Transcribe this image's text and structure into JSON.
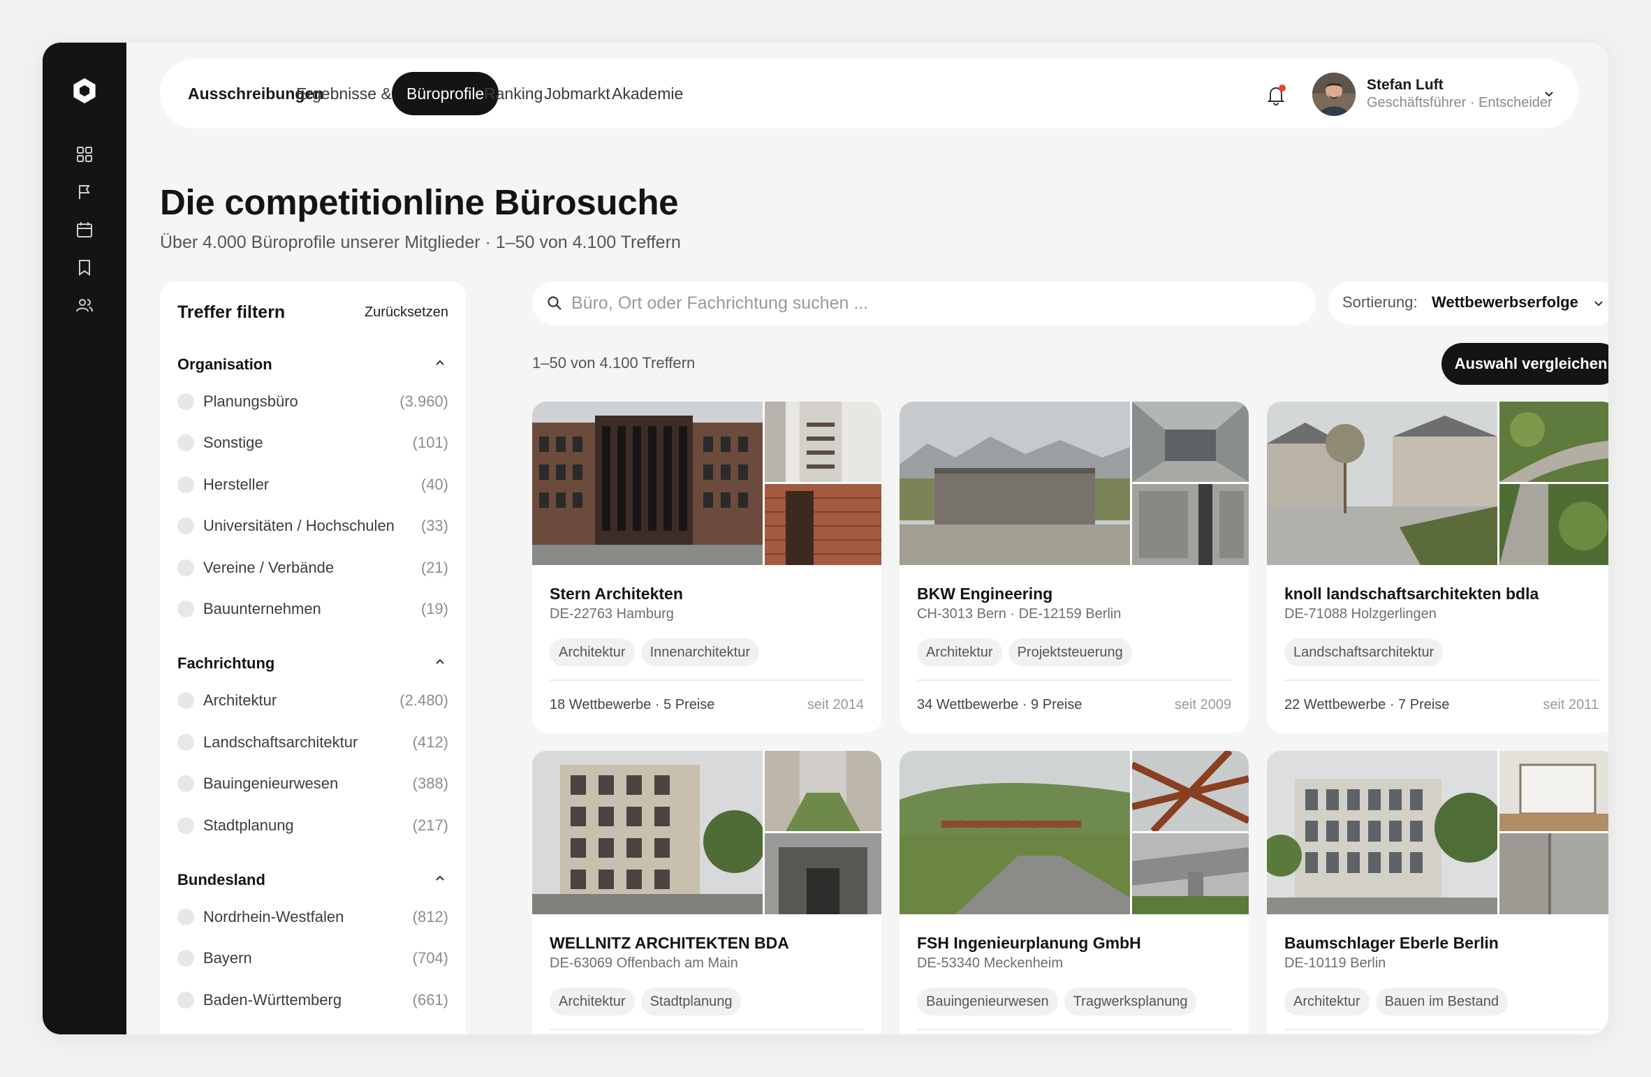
{
  "nav": {
    "tabs": [
      {
        "label": "Ausschreibungen"
      },
      {
        "label": "Ergebnisse & News"
      },
      {
        "label": "Büroprofile"
      },
      {
        "label": "Ranking"
      },
      {
        "label": "Jobmarkt"
      },
      {
        "label": "Akademie"
      }
    ],
    "active_tab": "Büroprofile"
  },
  "user": {
    "name": "Stefan Luft",
    "role": "Geschäftsführer · Entscheider"
  },
  "sidebar_icons": [
    "logo-icon",
    "grid-icon",
    "flag-icon",
    "calendar-icon",
    "bookmark-icon",
    "users-icon"
  ],
  "page": {
    "title": "Die competitionline Bürosuche",
    "subtitle": "Über 4.000 Büroprofile unserer Mitglieder · 1–50 von 4.100 Treffern"
  },
  "filters": {
    "title": "Treffer filtern",
    "reset_label": "Zurücksetzen",
    "groups": [
      {
        "title": "Organisation",
        "items": [
          {
            "label": "Planungsbüro",
            "count": "(3.960)"
          },
          {
            "label": "Sonstige",
            "count": "(101)"
          },
          {
            "label": "Hersteller",
            "count": "(40)"
          },
          {
            "label": "Universitäten / Hochschulen",
            "count": "(33)"
          },
          {
            "label": "Vereine / Verbände",
            "count": "(21)"
          },
          {
            "label": "Bauunternehmen",
            "count": "(19)"
          }
        ]
      },
      {
        "title": "Fachrichtung",
        "items": [
          {
            "label": "Architektur",
            "count": "(2.480)"
          },
          {
            "label": "Landschaftsarchitektur",
            "count": "(412)"
          },
          {
            "label": "Bauingenieurwesen",
            "count": "(388)"
          },
          {
            "label": "Stadtplanung",
            "count": "(217)"
          }
        ]
      },
      {
        "title": "Bundesland",
        "items": [
          {
            "label": "Nordrhein-Westfalen",
            "count": "(812)"
          },
          {
            "label": "Bayern",
            "count": "(704)"
          },
          {
            "label": "Baden-Württemberg",
            "count": "(661)"
          }
        ]
      }
    ]
  },
  "search": {
    "placeholder": "Büro, Ort oder Fachrichtung suchen ...",
    "value": ""
  },
  "sort": {
    "label": "Sortierung:",
    "value": "Wettbewerbserfolge"
  },
  "results": {
    "count_label": "1–50 von 4.100 Treffern",
    "compare_label": "Auswahl vergleichen"
  },
  "cards": [
    {
      "name": "Stern Architekten",
      "location": "DE-22763 Hamburg",
      "tags": [
        "Architektur",
        "Innenarchitektur"
      ],
      "stats": "18 Wettbewerbe · 5 Preise",
      "since": "seit 2014"
    },
    {
      "name": "BKW Engineering",
      "location": "CH-3013 Bern · DE-12159 Berlin",
      "tags": [
        "Architektur",
        "Projektsteuerung"
      ],
      "stats": "34 Wettbewerbe · 9 Preise",
      "since": "seit 2009"
    },
    {
      "name": "knoll landschaftsarchitekten bdla",
      "location": "DE-71088 Holzgerlingen",
      "tags": [
        "Landschaftsarchitektur"
      ],
      "stats": "22 Wettbewerbe · 7 Preise",
      "since": "seit 2011"
    },
    {
      "name": "WELLNITZ ARCHITEKTEN BDA",
      "location": "DE-63069 Offenbach am Main",
      "tags": [
        "Architektur",
        "Stadtplanung"
      ],
      "stats": "",
      "since": ""
    },
    {
      "name": "FSH Ingenieurplanung GmbH",
      "location": "DE-53340 Meckenheim",
      "tags": [
        "Bauingenieurwesen",
        "Tragwerksplanung"
      ],
      "stats": "",
      "since": ""
    },
    {
      "name": "Baumschlager Eberle Berlin",
      "location": "DE-10119 Berlin",
      "tags": [
        "Architektur",
        "Bauen im Bestand"
      ],
      "stats": "",
      "since": ""
    }
  ]
}
